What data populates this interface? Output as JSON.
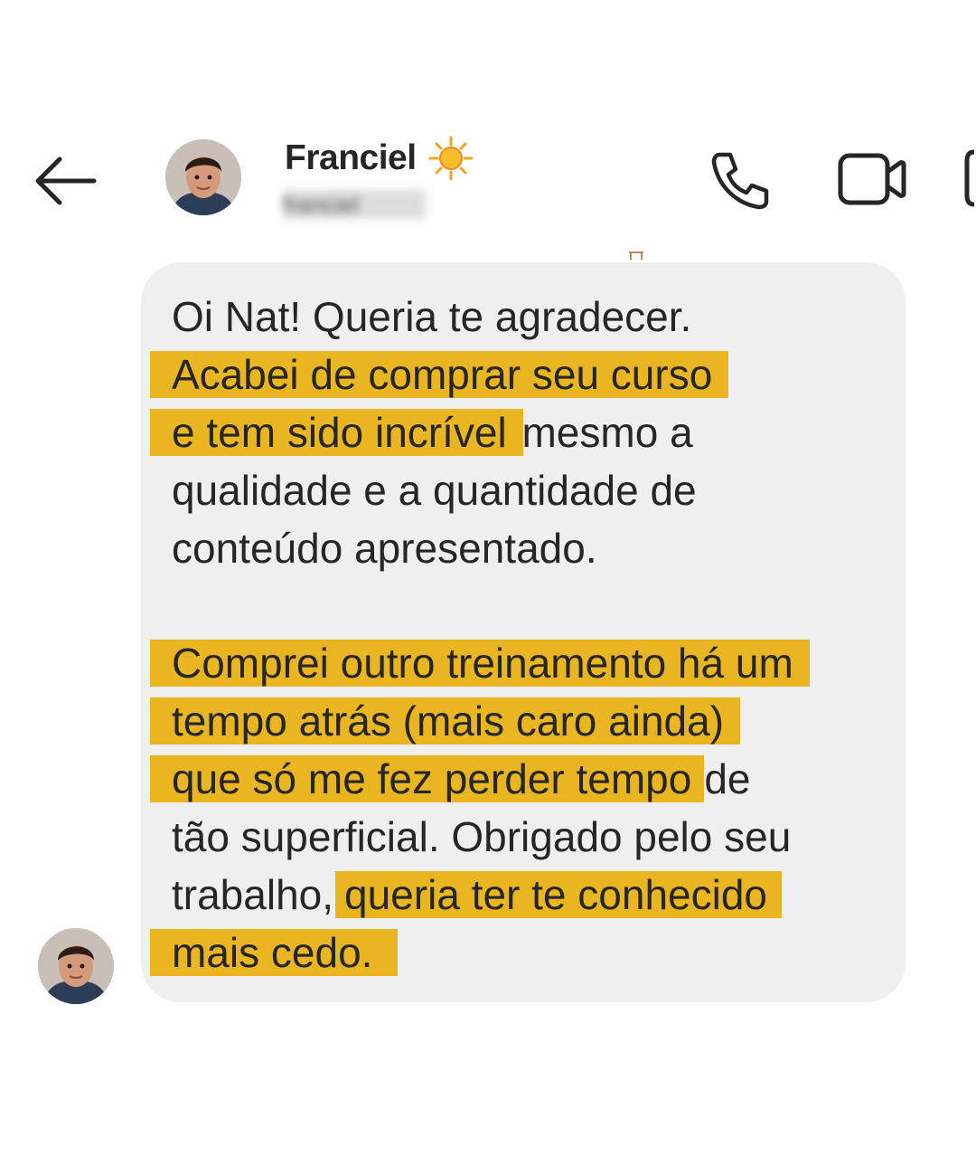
{
  "header": {
    "back_icon": "arrow-left-icon",
    "contact_name": "Franciel",
    "name_emoji": "☀️",
    "username": "franciel",
    "call_icon": "phone-icon",
    "video_icon": "video-camera-icon"
  },
  "message": {
    "lines": [
      {
        "plain": "Oi Nat! Queria te agradecer.",
        "hl": ""
      },
      {
        "plain": "",
        "hl": "Acabei de comprar seu curso"
      },
      {
        "plain": "mesmo a",
        "hl": "e tem sido incrível"
      },
      {
        "plain": "qualidade e a quantidade de",
        "hl": ""
      },
      {
        "plain": "conteúdo apresentado.",
        "hl": ""
      },
      {
        "plain": "",
        "hl": "Comprei outro treinamento há um"
      },
      {
        "plain": "",
        "hl": "tempo atrás (mais caro ainda)"
      },
      {
        "plain": "de",
        "hl": "que só me fez perder tempo"
      },
      {
        "plain": "tão superficial. Obrigado pelo seu",
        "hl": ""
      },
      {
        "plain": "trabalho,",
        "hl": "queria ter te conhecido"
      },
      {
        "plain": "",
        "hl": "mais cedo."
      }
    ]
  },
  "colors": {
    "highlight": "#e9b521",
    "bubble": "#efefef",
    "text": "#262626"
  }
}
